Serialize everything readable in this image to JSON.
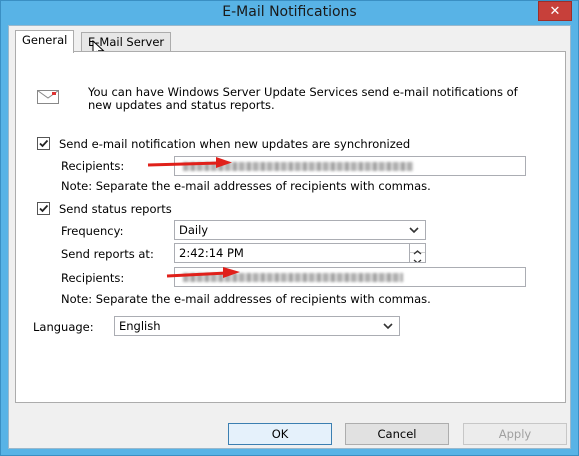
{
  "window": {
    "title": "E-Mail Notifications",
    "close_glyph": "✕"
  },
  "tabs": [
    {
      "label": "General",
      "active": true
    },
    {
      "label": "E-Mail Server",
      "active": false
    }
  ],
  "general": {
    "intro_text": "You can have Windows Server Update Services send e-mail notifications of new updates and status reports.",
    "sync_notification": {
      "checked": true,
      "label": "Send e-mail notification when new updates are synchronized",
      "recipients_label": "Recipients:",
      "recipients_value": "",
      "note": "Note: Separate the e-mail addresses of recipients with commas."
    },
    "status_reports": {
      "checked": true,
      "label": "Send status reports",
      "frequency_label": "Frequency:",
      "frequency_value": "Daily",
      "send_at_label": "Send reports at:",
      "send_at_value": "2:42:14 PM",
      "recipients_label": "Recipients:",
      "recipients_value": "",
      "note": "Note: Separate the e-mail addresses of recipients with commas."
    },
    "language_label": "Language:",
    "language_value": "English"
  },
  "buttons": {
    "ok": "OK",
    "cancel": "Cancel",
    "apply": "Apply"
  },
  "colors": {
    "annotation_arrow": "#e0201a",
    "title_bar": "#58b3e6",
    "close_button": "#c7403a"
  },
  "icons": [
    "close-icon",
    "mail-icon",
    "checkmark-icon",
    "chevron-down-icon",
    "spin-up-icon",
    "spin-down-icon",
    "mouse-cursor-icon",
    "annotation-arrow"
  ]
}
